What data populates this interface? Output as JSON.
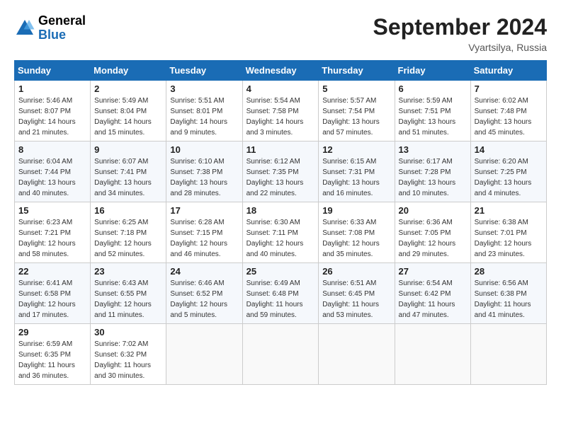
{
  "header": {
    "logo": {
      "general": "General",
      "blue": "Blue"
    },
    "title": "September 2024",
    "location": "Vyartsilya, Russia"
  },
  "weekdays": [
    "Sunday",
    "Monday",
    "Tuesday",
    "Wednesday",
    "Thursday",
    "Friday",
    "Saturday"
  ],
  "weeks": [
    [
      {
        "day": "1",
        "info": "Sunrise: 5:46 AM\nSunset: 8:07 PM\nDaylight: 14 hours\nand 21 minutes."
      },
      {
        "day": "2",
        "info": "Sunrise: 5:49 AM\nSunset: 8:04 PM\nDaylight: 14 hours\nand 15 minutes."
      },
      {
        "day": "3",
        "info": "Sunrise: 5:51 AM\nSunset: 8:01 PM\nDaylight: 14 hours\nand 9 minutes."
      },
      {
        "day": "4",
        "info": "Sunrise: 5:54 AM\nSunset: 7:58 PM\nDaylight: 14 hours\nand 3 minutes."
      },
      {
        "day": "5",
        "info": "Sunrise: 5:57 AM\nSunset: 7:54 PM\nDaylight: 13 hours\nand 57 minutes."
      },
      {
        "day": "6",
        "info": "Sunrise: 5:59 AM\nSunset: 7:51 PM\nDaylight: 13 hours\nand 51 minutes."
      },
      {
        "day": "7",
        "info": "Sunrise: 6:02 AM\nSunset: 7:48 PM\nDaylight: 13 hours\nand 45 minutes."
      }
    ],
    [
      {
        "day": "8",
        "info": "Sunrise: 6:04 AM\nSunset: 7:44 PM\nDaylight: 13 hours\nand 40 minutes."
      },
      {
        "day": "9",
        "info": "Sunrise: 6:07 AM\nSunset: 7:41 PM\nDaylight: 13 hours\nand 34 minutes."
      },
      {
        "day": "10",
        "info": "Sunrise: 6:10 AM\nSunset: 7:38 PM\nDaylight: 13 hours\nand 28 minutes."
      },
      {
        "day": "11",
        "info": "Sunrise: 6:12 AM\nSunset: 7:35 PM\nDaylight: 13 hours\nand 22 minutes."
      },
      {
        "day": "12",
        "info": "Sunrise: 6:15 AM\nSunset: 7:31 PM\nDaylight: 13 hours\nand 16 minutes."
      },
      {
        "day": "13",
        "info": "Sunrise: 6:17 AM\nSunset: 7:28 PM\nDaylight: 13 hours\nand 10 minutes."
      },
      {
        "day": "14",
        "info": "Sunrise: 6:20 AM\nSunset: 7:25 PM\nDaylight: 13 hours\nand 4 minutes."
      }
    ],
    [
      {
        "day": "15",
        "info": "Sunrise: 6:23 AM\nSunset: 7:21 PM\nDaylight: 12 hours\nand 58 minutes."
      },
      {
        "day": "16",
        "info": "Sunrise: 6:25 AM\nSunset: 7:18 PM\nDaylight: 12 hours\nand 52 minutes."
      },
      {
        "day": "17",
        "info": "Sunrise: 6:28 AM\nSunset: 7:15 PM\nDaylight: 12 hours\nand 46 minutes."
      },
      {
        "day": "18",
        "info": "Sunrise: 6:30 AM\nSunset: 7:11 PM\nDaylight: 12 hours\nand 40 minutes."
      },
      {
        "day": "19",
        "info": "Sunrise: 6:33 AM\nSunset: 7:08 PM\nDaylight: 12 hours\nand 35 minutes."
      },
      {
        "day": "20",
        "info": "Sunrise: 6:36 AM\nSunset: 7:05 PM\nDaylight: 12 hours\nand 29 minutes."
      },
      {
        "day": "21",
        "info": "Sunrise: 6:38 AM\nSunset: 7:01 PM\nDaylight: 12 hours\nand 23 minutes."
      }
    ],
    [
      {
        "day": "22",
        "info": "Sunrise: 6:41 AM\nSunset: 6:58 PM\nDaylight: 12 hours\nand 17 minutes."
      },
      {
        "day": "23",
        "info": "Sunrise: 6:43 AM\nSunset: 6:55 PM\nDaylight: 12 hours\nand 11 minutes."
      },
      {
        "day": "24",
        "info": "Sunrise: 6:46 AM\nSunset: 6:52 PM\nDaylight: 12 hours\nand 5 minutes."
      },
      {
        "day": "25",
        "info": "Sunrise: 6:49 AM\nSunset: 6:48 PM\nDaylight: 11 hours\nand 59 minutes."
      },
      {
        "day": "26",
        "info": "Sunrise: 6:51 AM\nSunset: 6:45 PM\nDaylight: 11 hours\nand 53 minutes."
      },
      {
        "day": "27",
        "info": "Sunrise: 6:54 AM\nSunset: 6:42 PM\nDaylight: 11 hours\nand 47 minutes."
      },
      {
        "day": "28",
        "info": "Sunrise: 6:56 AM\nSunset: 6:38 PM\nDaylight: 11 hours\nand 41 minutes."
      }
    ],
    [
      {
        "day": "29",
        "info": "Sunrise: 6:59 AM\nSunset: 6:35 PM\nDaylight: 11 hours\nand 36 minutes."
      },
      {
        "day": "30",
        "info": "Sunrise: 7:02 AM\nSunset: 6:32 PM\nDaylight: 11 hours\nand 30 minutes."
      },
      {
        "day": "",
        "info": ""
      },
      {
        "day": "",
        "info": ""
      },
      {
        "day": "",
        "info": ""
      },
      {
        "day": "",
        "info": ""
      },
      {
        "day": "",
        "info": ""
      }
    ]
  ]
}
